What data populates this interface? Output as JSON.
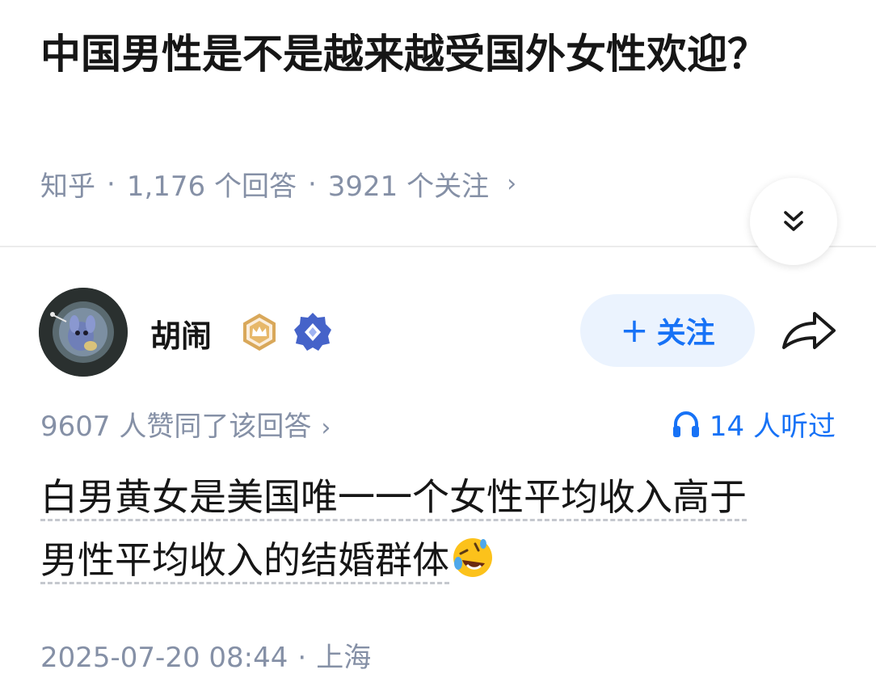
{
  "question": {
    "title": "中国男性是不是越来越受国外女性欢迎？",
    "source": "知乎",
    "separator": "·",
    "answer_count": "1,176 个回答",
    "follower_count": "3921 个关注",
    "chevron": "›"
  },
  "author": {
    "name": "胡闹",
    "badges": [
      "crown-badge-icon",
      "diamond-badge-icon"
    ],
    "follow_label": "关注",
    "follow_plus": "+"
  },
  "answer": {
    "upvote_text": "9607 人赞同了该回答",
    "listened_text": "14 人听过",
    "content_line1": "白男黄女是美国唯一一个女性平均收入高于",
    "content_line2": "男性平均收入的结婚群体",
    "emoji": "rolling-on-floor-laughing",
    "date": "2025-07-20 08:44",
    "location": "上海"
  },
  "colors": {
    "accent": "#1772f6",
    "muted": "#8590a6",
    "follow_bg": "#ebf3fe"
  }
}
